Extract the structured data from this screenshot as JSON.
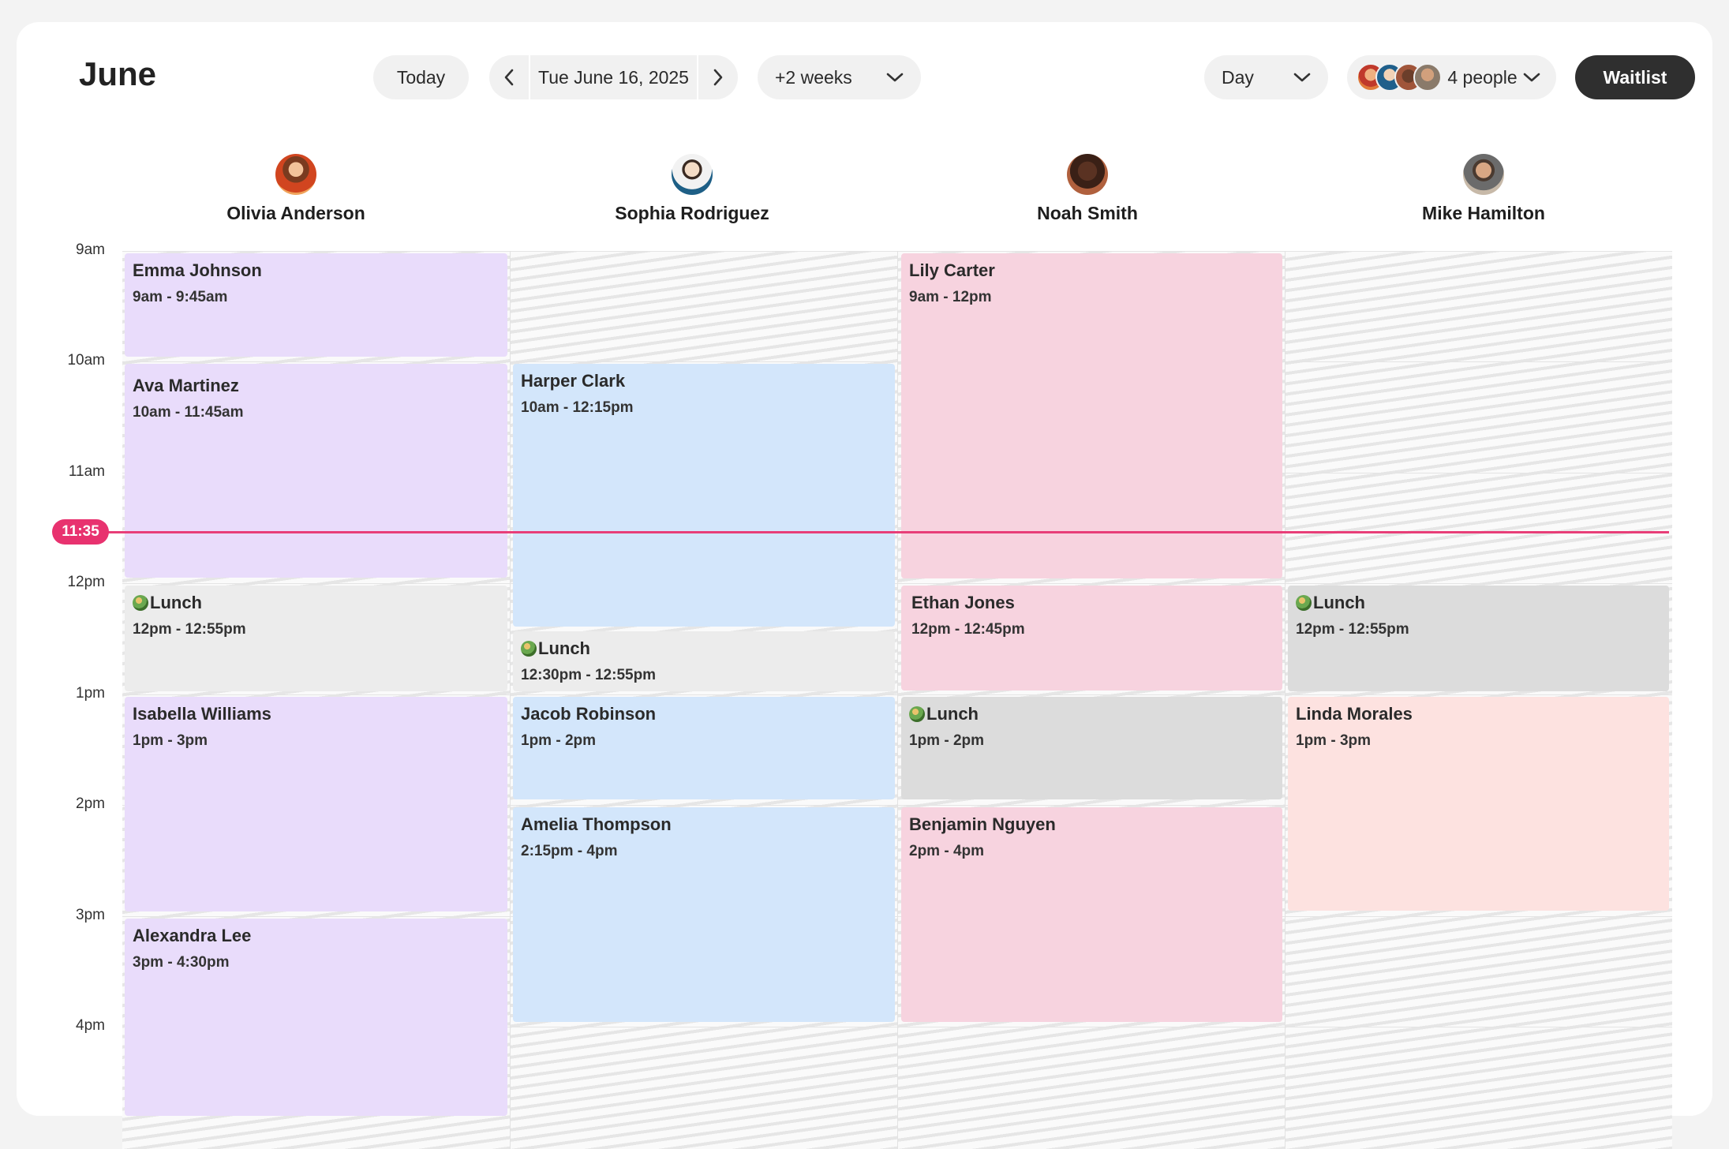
{
  "header": {
    "month": "June",
    "today_label": "Today",
    "date_label": "Tue June 16, 2025",
    "range_label": "+2 weeks",
    "view_label": "Day",
    "people_label": "4 people",
    "waitlist_label": "Waitlist"
  },
  "colors": {
    "purple": "#e9dcfb",
    "blue": "#d3e6fb",
    "pink": "#f7d3df",
    "lunch_gray": "#ececec",
    "lunch_dark_gray": "#dcdcdc",
    "peach": "#fde2e0",
    "now_line": "#e83e78",
    "primary_button": "#2f2f2f"
  },
  "staff": [
    {
      "name": "Olivia Anderson"
    },
    {
      "name": "Sophia Rodriguez"
    },
    {
      "name": "Noah Smith"
    },
    {
      "name": "Mike Hamilton"
    }
  ],
  "time_labels": [
    "9am",
    "10am",
    "11am",
    "12pm",
    "1pm",
    "2pm",
    "3pm",
    "4pm"
  ],
  "now_time": "11:35",
  "events": [
    {
      "title": "Emma Johnson",
      "time": "9am - 9:45am"
    },
    {
      "title": "Ava Martinez",
      "time": "10am - 11:45am"
    },
    {
      "title": "Lunch",
      "time": "12pm - 12:55pm"
    },
    {
      "title": "Isabella Williams",
      "time": "1pm - 3pm"
    },
    {
      "title": "Alexandra Lee",
      "time": "3pm - 4:30pm"
    },
    {
      "title": "Harper Clark",
      "time": "10am - 12:15pm"
    },
    {
      "title": "Lunch",
      "time": "12:30pm - 12:55pm"
    },
    {
      "title": "Jacob Robinson",
      "time": "1pm - 2pm"
    },
    {
      "title": "Amelia Thompson",
      "time": "2:15pm - 4pm"
    },
    {
      "title": "Lily Carter",
      "time": "9am - 12pm"
    },
    {
      "title": "Ethan Jones",
      "time": "12pm - 12:45pm"
    },
    {
      "title": "Lunch",
      "time": "1pm - 2pm"
    },
    {
      "title": "Benjamin Nguyen",
      "time": "2pm - 4pm"
    },
    {
      "title": "Lunch",
      "time": "12pm - 12:55pm"
    },
    {
      "title": "Linda Morales",
      "time": "1pm - 3pm"
    }
  ]
}
